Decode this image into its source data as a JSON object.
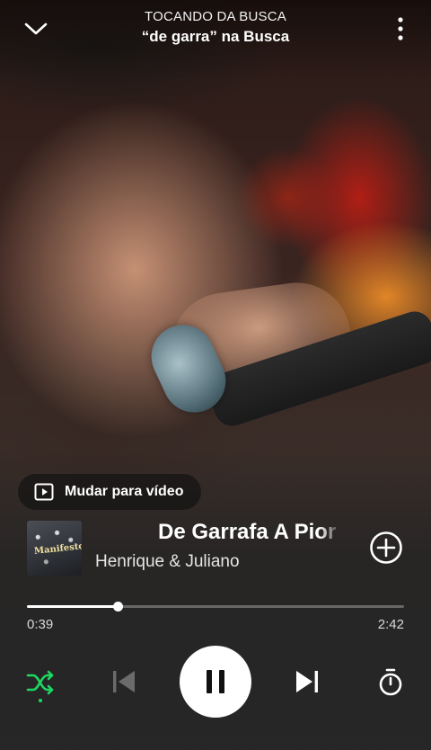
{
  "header": {
    "subtitle": "TOCANDO DA BUSCA",
    "title": "“de garra” na Busca"
  },
  "video_toggle": {
    "label": "Mudar para vídeo"
  },
  "track": {
    "title": "De Garrafa A Pior",
    "artist": "Henrique & Juliano",
    "cover_text": "Manifesto"
  },
  "progress": {
    "elapsed": "0:39",
    "duration": "2:42",
    "fraction": 0.24
  },
  "colors": {
    "accent": "#1ed760",
    "foreground": "#ffffff"
  },
  "icons": {
    "collapse": "chevron-down-icon",
    "menu": "more-vertical-icon",
    "video": "play-square-icon",
    "add": "plus-circle-icon",
    "shuffle": "shuffle-icon",
    "previous": "skip-previous-icon",
    "playback": "pause-icon",
    "next": "skip-next-icon",
    "sleep_timer": "timer-icon"
  },
  "state": {
    "shuffle_on": true,
    "previous_enabled": false,
    "playing": true
  }
}
